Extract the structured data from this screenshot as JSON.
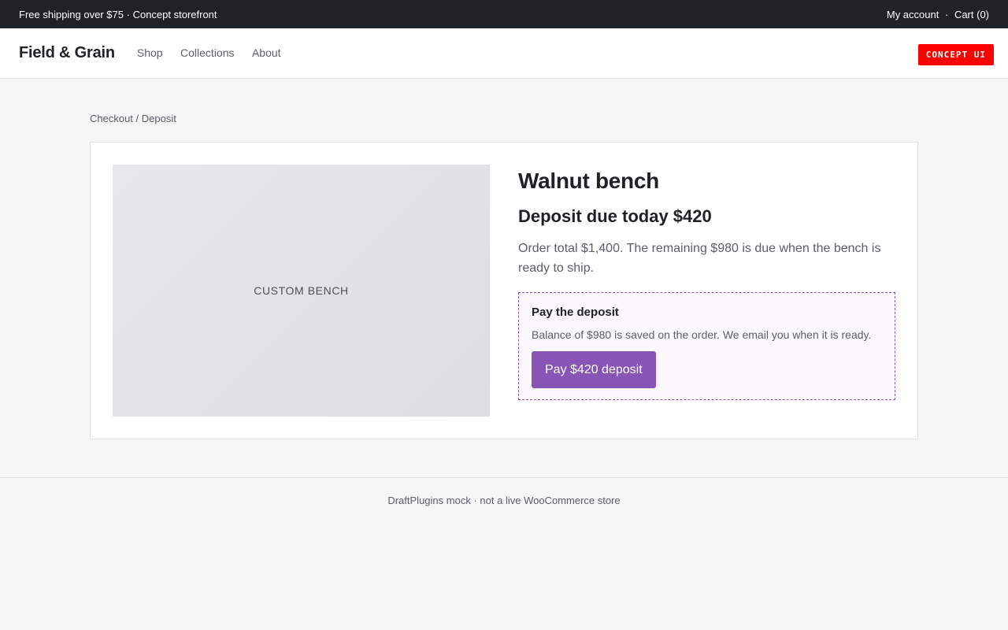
{
  "topbar": {
    "left_text": "Free shipping over $75",
    "left_separator": "·",
    "left_text2": "Concept storefront",
    "my_account": "My account",
    "separator": "·",
    "cart": "Cart (0)"
  },
  "header": {
    "brand": "Field & Grain",
    "nav": [
      "Shop",
      "Collections",
      "About"
    ],
    "badge": "CONCEPT UI"
  },
  "breadcrumb": {
    "parent": "Checkout",
    "separator": " / ",
    "current": "Deposit"
  },
  "product": {
    "image_label": "CUSTOM BENCH",
    "title": "Walnut bench",
    "deposit_due": "Deposit due today $420",
    "order_text": "Order total $1,400. The remaining $980 is due when the bench is ready to ship."
  },
  "deposit_box": {
    "title": "Pay the deposit",
    "text": "Balance of $980 is saved on the order. We email you when it is ready.",
    "button": "Pay $420 deposit"
  },
  "footer": {
    "text": "DraftPlugins mock",
    "separator": "·",
    "text2": "not a live WooCommerce store"
  },
  "colors": {
    "topbar_bg": "#1f2328",
    "accent_purple": "#8755b6",
    "badge_red": "#ff0000",
    "page_bg": "#f5f6f5"
  }
}
